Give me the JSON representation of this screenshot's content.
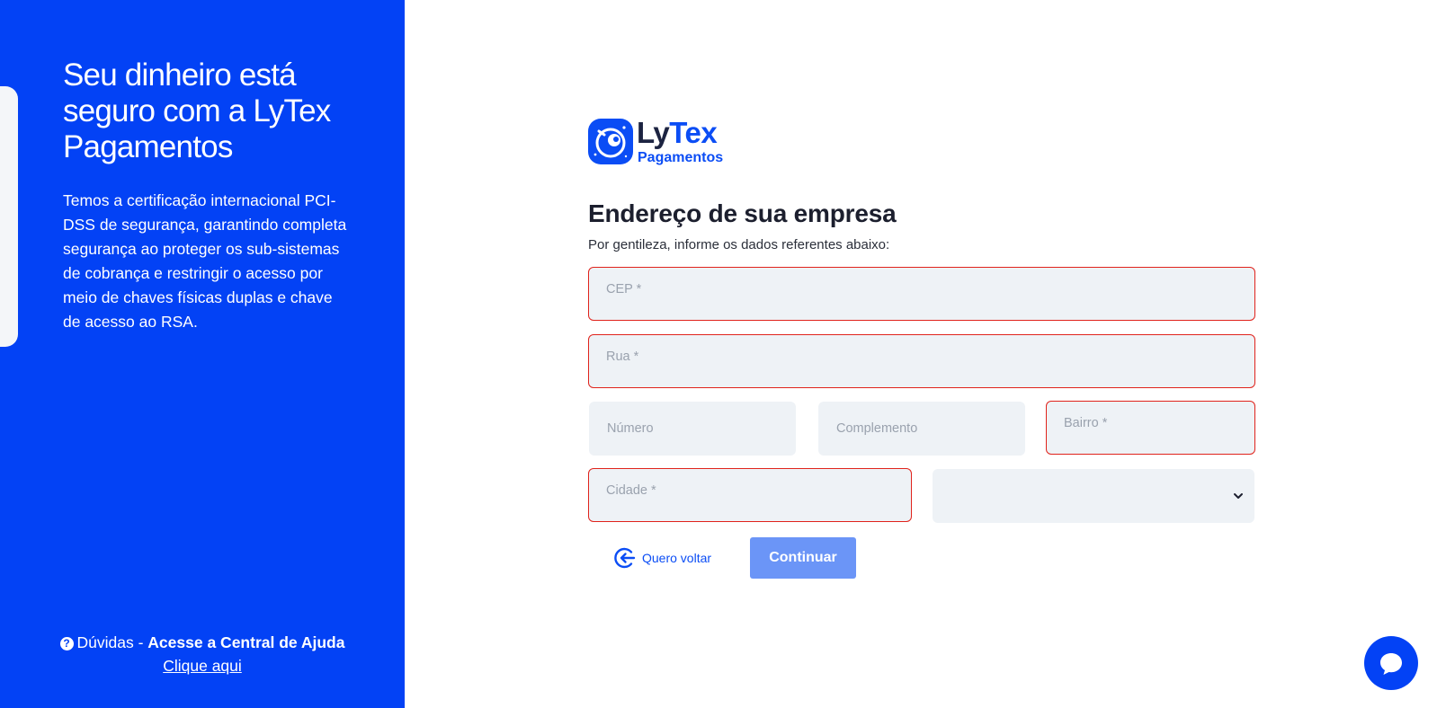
{
  "left_panel": {
    "heading": "Seu dinheiro está seguro com a LyTex Pagamentos",
    "description": "Temos a certificação internacional PCI-DSS de segurança, garantindo completa segurança ao proteger os sub-sistemas de cobrança e restringir o acesso por meio de chaves físicas duplas e chave de acesso ao RSA.",
    "help": {
      "icon": "question-circle-icon",
      "prefix": "Dúvidas - ",
      "emphasis": "Acesse a Central de Ajuda",
      "link_label": "Clique aqui"
    }
  },
  "logo": {
    "word_part1": "Ly",
    "word_part2": "Tex",
    "subtitle": "Pagamentos",
    "icon": "astronaut-icon"
  },
  "form": {
    "title": "Endereço de sua empresa",
    "subtitle": "Por gentileza, informe os dados referentes abaixo:",
    "fields": {
      "cep": {
        "placeholder": "CEP *",
        "value": ""
      },
      "rua": {
        "placeholder": "Rua *",
        "value": ""
      },
      "numero": {
        "placeholder": "Número",
        "value": ""
      },
      "complemento": {
        "placeholder": "Complemento",
        "value": ""
      },
      "bairro": {
        "placeholder": "Bairro *",
        "value": ""
      },
      "cidade": {
        "placeholder": "Cidade *",
        "value": ""
      },
      "estado": {
        "value": ""
      }
    },
    "back_label": "Quero voltar",
    "continue_label": "Continuar"
  },
  "chat": {
    "icon": "chat-bubble-icon"
  },
  "colors": {
    "brand_blue": "#0342f5",
    "error_red": "#e0231c",
    "input_bg": "#eef2f6",
    "button_disabled": "#6b95f7"
  }
}
